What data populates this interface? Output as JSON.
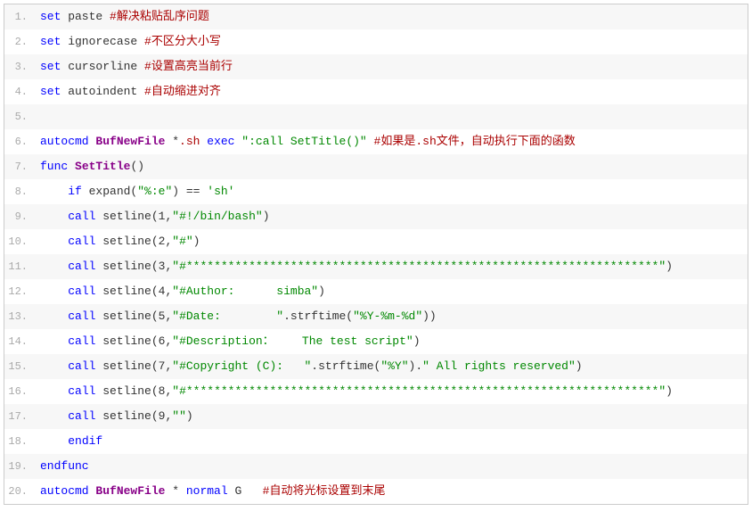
{
  "lines": [
    {
      "n": 1,
      "tokens": [
        {
          "c": "kw",
          "t": "set"
        },
        {
          "c": "id",
          "t": " paste "
        },
        {
          "c": "cmt",
          "t": "#解决粘贴乱序问题"
        }
      ]
    },
    {
      "n": 2,
      "tokens": [
        {
          "c": "kw",
          "t": "set"
        },
        {
          "c": "id",
          "t": " ignorecase "
        },
        {
          "c": "cmt",
          "t": "#不区分大小写"
        }
      ]
    },
    {
      "n": 3,
      "tokens": [
        {
          "c": "kw",
          "t": "set"
        },
        {
          "c": "id",
          "t": " cursorline "
        },
        {
          "c": "cmt",
          "t": "#设置高亮当前行"
        }
      ]
    },
    {
      "n": 4,
      "tokens": [
        {
          "c": "kw",
          "t": "set"
        },
        {
          "c": "id",
          "t": " autoindent "
        },
        {
          "c": "cmt",
          "t": "#自动缩进对齐"
        }
      ]
    },
    {
      "n": 5,
      "tokens": [
        {
          "c": "id",
          "t": " "
        }
      ]
    },
    {
      "n": 6,
      "tokens": [
        {
          "c": "kw",
          "t": "autocmd"
        },
        {
          "c": "id",
          "t": " "
        },
        {
          "c": "func",
          "t": "BufNewFile"
        },
        {
          "c": "id",
          "t": " *"
        },
        {
          "c": "sh",
          "t": ".sh"
        },
        {
          "c": "id",
          "t": " "
        },
        {
          "c": "kw",
          "t": "exec"
        },
        {
          "c": "id",
          "t": " "
        },
        {
          "c": "str",
          "t": "\":call SetTitle()\""
        },
        {
          "c": "id",
          "t": " "
        },
        {
          "c": "cmt",
          "t": "#如果是.sh文件，自动执行下面的函数"
        }
      ]
    },
    {
      "n": 7,
      "tokens": [
        {
          "c": "kw",
          "t": "func"
        },
        {
          "c": "id",
          "t": " "
        },
        {
          "c": "func",
          "t": "SetTitle"
        },
        {
          "c": "id",
          "t": "()"
        }
      ]
    },
    {
      "n": 8,
      "tokens": [
        {
          "c": "id",
          "t": "    "
        },
        {
          "c": "kw",
          "t": "if"
        },
        {
          "c": "id",
          "t": " expand("
        },
        {
          "c": "str",
          "t": "\"%:e\""
        },
        {
          "c": "id",
          "t": ") == "
        },
        {
          "c": "str",
          "t": "'sh'"
        }
      ]
    },
    {
      "n": 9,
      "tokens": [
        {
          "c": "id",
          "t": "    "
        },
        {
          "c": "kw",
          "t": "call"
        },
        {
          "c": "id",
          "t": " setline(1,"
        },
        {
          "c": "str",
          "t": "\"#!/bin/bash\""
        },
        {
          "c": "id",
          "t": ")"
        }
      ]
    },
    {
      "n": 10,
      "tokens": [
        {
          "c": "id",
          "t": "    "
        },
        {
          "c": "kw",
          "t": "call"
        },
        {
          "c": "id",
          "t": " setline(2,"
        },
        {
          "c": "str",
          "t": "\"#\""
        },
        {
          "c": "id",
          "t": ")"
        }
      ]
    },
    {
      "n": 11,
      "tokens": [
        {
          "c": "id",
          "t": "    "
        },
        {
          "c": "kw",
          "t": "call"
        },
        {
          "c": "id",
          "t": " setline(3,"
        },
        {
          "c": "str",
          "t": "\"#********************************************************************\""
        },
        {
          "c": "id",
          "t": ")"
        }
      ]
    },
    {
      "n": 12,
      "tokens": [
        {
          "c": "id",
          "t": "    "
        },
        {
          "c": "kw",
          "t": "call"
        },
        {
          "c": "id",
          "t": " setline(4,"
        },
        {
          "c": "str",
          "t": "\"#Author:      simba\""
        },
        {
          "c": "id",
          "t": ")"
        }
      ]
    },
    {
      "n": 13,
      "tokens": [
        {
          "c": "id",
          "t": "    "
        },
        {
          "c": "kw",
          "t": "call"
        },
        {
          "c": "id",
          "t": " setline(5,"
        },
        {
          "c": "str",
          "t": "\"#Date:        \""
        },
        {
          "c": "id",
          "t": ".strftime("
        },
        {
          "c": "str",
          "t": "\"%Y-%m-%d\""
        },
        {
          "c": "id",
          "t": "))"
        }
      ]
    },
    {
      "n": 14,
      "tokens": [
        {
          "c": "id",
          "t": "    "
        },
        {
          "c": "kw",
          "t": "call"
        },
        {
          "c": "id",
          "t": " setline(6,"
        },
        {
          "c": "str",
          "t": "\"#Description：    The test script\""
        },
        {
          "c": "id",
          "t": ")"
        }
      ]
    },
    {
      "n": 15,
      "tokens": [
        {
          "c": "id",
          "t": "    "
        },
        {
          "c": "kw",
          "t": "call"
        },
        {
          "c": "id",
          "t": " setline(7,"
        },
        {
          "c": "str",
          "t": "\"#Copyright (C):   \""
        },
        {
          "c": "id",
          "t": ".strftime("
        },
        {
          "c": "str",
          "t": "\"%Y\""
        },
        {
          "c": "id",
          "t": ")."
        },
        {
          "c": "str",
          "t": "\" All rights reserved\""
        },
        {
          "c": "id",
          "t": ")"
        }
      ]
    },
    {
      "n": 16,
      "tokens": [
        {
          "c": "id",
          "t": "    "
        },
        {
          "c": "kw",
          "t": "call"
        },
        {
          "c": "id",
          "t": " setline(8,"
        },
        {
          "c": "str",
          "t": "\"#********************************************************************\""
        },
        {
          "c": "id",
          "t": ")"
        }
      ]
    },
    {
      "n": 17,
      "tokens": [
        {
          "c": "id",
          "t": "    "
        },
        {
          "c": "kw",
          "t": "call"
        },
        {
          "c": "id",
          "t": " setline(9,"
        },
        {
          "c": "str",
          "t": "\"\""
        },
        {
          "c": "id",
          "t": ")"
        }
      ]
    },
    {
      "n": 18,
      "tokens": [
        {
          "c": "id",
          "t": "    "
        },
        {
          "c": "kw",
          "t": "endif"
        }
      ]
    },
    {
      "n": 19,
      "tokens": [
        {
          "c": "kw",
          "t": "endfunc"
        }
      ]
    },
    {
      "n": 20,
      "tokens": [
        {
          "c": "kw",
          "t": "autocmd"
        },
        {
          "c": "id",
          "t": " "
        },
        {
          "c": "func",
          "t": "BufNewFile"
        },
        {
          "c": "id",
          "t": " * "
        },
        {
          "c": "kw",
          "t": "normal"
        },
        {
          "c": "id",
          "t": " G   "
        },
        {
          "c": "cmt",
          "t": "#自动将光标设置到末尾"
        }
      ]
    }
  ]
}
